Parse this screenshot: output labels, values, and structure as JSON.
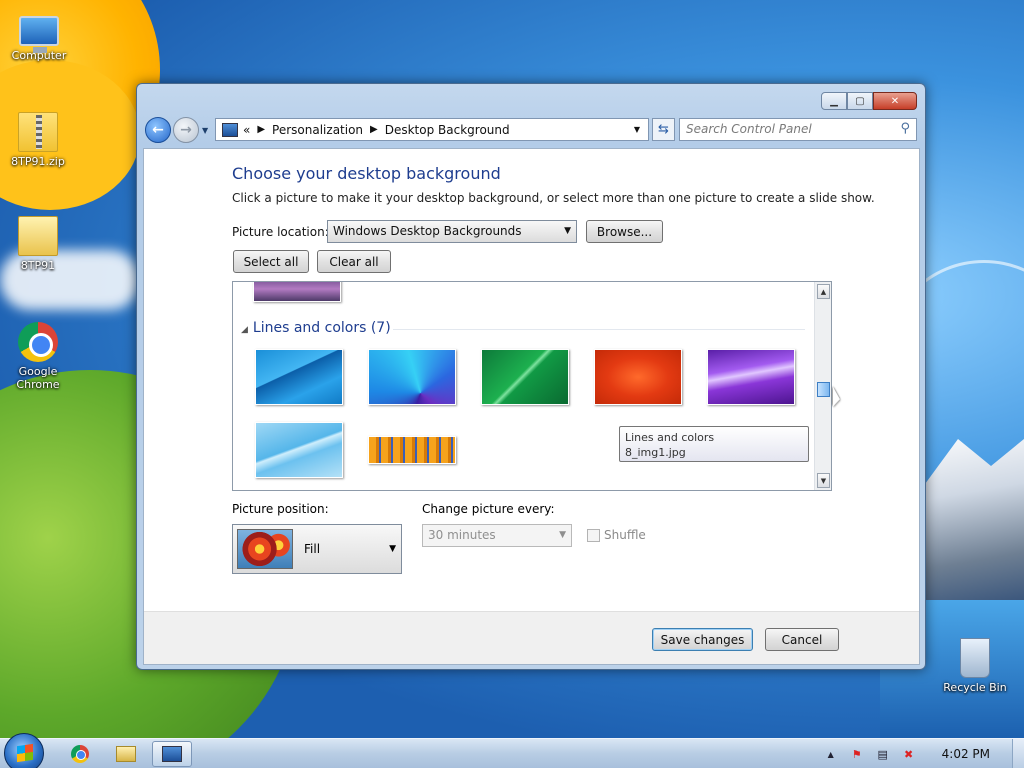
{
  "desktop": {
    "icons": [
      {
        "label": "Computer",
        "icon": "computer-icon"
      },
      {
        "label": "8TP91.zip",
        "icon": "zip-file-icon"
      },
      {
        "label": "8TP91",
        "icon": "folder-icon"
      },
      {
        "label": "Google Chrome",
        "icon": "chrome-icon"
      },
      {
        "label": "Recycle Bin",
        "icon": "recycle-bin-icon"
      }
    ]
  },
  "window": {
    "caption_buttons": {
      "minimize": "▁",
      "maximize": "▢",
      "close": "✕"
    },
    "address": {
      "prefix": "«",
      "crumbs": [
        "Personalization",
        "Desktop Background"
      ]
    },
    "search_placeholder": "Search Control Panel",
    "heading": "Choose your desktop background",
    "subheading": "Click a picture to make it your desktop background, or select more than one picture to create a slide show.",
    "picture_location_label": "Picture location:",
    "picture_location_value": "Windows Desktop Backgrounds",
    "browse_label": "Browse...",
    "select_all_label": "Select all",
    "clear_all_label": "Clear all",
    "gallery": {
      "group_title": "Lines and colors (7)",
      "tooltip_line1": "Lines and colors",
      "tooltip_line2": "8_img1.jpg",
      "scroll_fraction": 0.55
    },
    "picture_position_label": "Picture position:",
    "picture_position_value": "Fill",
    "change_picture_label": "Change picture every:",
    "change_picture_value": "30 minutes",
    "shuffle_label": "Shuffle",
    "save_label": "Save changes",
    "cancel_label": "Cancel"
  },
  "taskbar": {
    "clock": "4:02 PM",
    "pinned": [
      "Google Chrome",
      "Windows Explorer",
      "Control Panel"
    ]
  },
  "colors": {
    "heading": "#1e3d8f",
    "accent": "#2466c9"
  }
}
